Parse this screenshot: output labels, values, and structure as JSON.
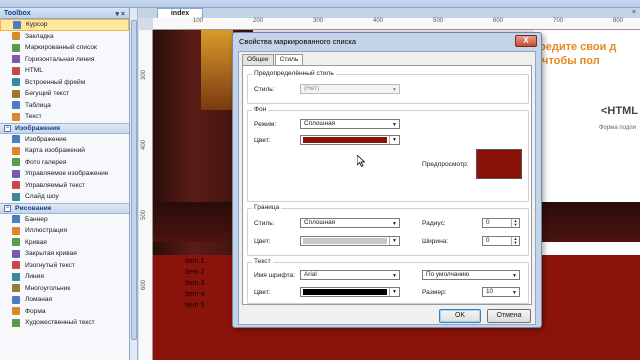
{
  "colors": {
    "accent": "#e38a1f",
    "dark_red": "#8b1208",
    "selection": "#ffe79c"
  },
  "toolbox": {
    "title": "Toolbox",
    "pin": "▾ ×",
    "items_top": [
      {
        "label": "Курсор",
        "icon": "cursor-icon",
        "selected": true
      },
      {
        "label": "Закладка",
        "icon": "bookmark-icon"
      },
      {
        "label": "Маркированный список",
        "icon": "bulleted-list-icon"
      },
      {
        "label": "Горизонтальная линия",
        "icon": "horizontal-line-icon"
      },
      {
        "label": "HTML",
        "icon": "html-icon"
      },
      {
        "label": "Встроенный фрейм",
        "icon": "iframe-icon"
      },
      {
        "label": "Бегущий текст",
        "icon": "marquee-icon"
      },
      {
        "label": "Таблица",
        "icon": "table-icon"
      },
      {
        "label": "Текст",
        "icon": "text-icon"
      }
    ],
    "group_images": "Изображения",
    "items_images": [
      {
        "label": "Изображение",
        "icon": "image-icon"
      },
      {
        "label": "Карта изображений",
        "icon": "image-map-icon"
      },
      {
        "label": "Фото галерея",
        "icon": "photo-gallery-icon"
      },
      {
        "label": "Управляемое изображение",
        "icon": "managed-image-icon"
      },
      {
        "label": "Управляемый текст",
        "icon": "managed-text-icon"
      },
      {
        "label": "Слайд шоу",
        "icon": "slideshow-icon"
      }
    ],
    "group_draw": "Рисование",
    "items_draw": [
      {
        "label": "Баннер",
        "icon": "banner-icon"
      },
      {
        "label": "Иллюстрация",
        "icon": "illustration-icon"
      },
      {
        "label": "Кривая",
        "icon": "curve-icon"
      },
      {
        "label": "Закрытая кривая",
        "icon": "closed-curve-icon"
      },
      {
        "label": "Изогнутый текст",
        "icon": "curved-text-icon"
      },
      {
        "label": "Линия",
        "icon": "line-icon"
      },
      {
        "label": "Многоугольник",
        "icon": "polygon-icon"
      },
      {
        "label": "Ломаная",
        "icon": "polyline-icon"
      },
      {
        "label": "Форма",
        "icon": "shape-icon"
      },
      {
        "label": "Художественный текст",
        "icon": "art-text-icon"
      }
    ]
  },
  "editor": {
    "tab": "index",
    "tab_close": "×",
    "ruler_h": [
      "100",
      "200",
      "300",
      "400",
      "500",
      "600",
      "700",
      "800"
    ],
    "ruler_v": [
      "300",
      "400",
      "500",
      "600"
    ],
    "canvas_text_orange": "редите свои д\n чтобы пол",
    "canvas_html": "<HTML",
    "canvas_forma": "Форма подпи",
    "list_items": [
      "Item 1",
      "Item 2",
      "Item 3",
      "Item 4",
      "Item 5"
    ]
  },
  "dialog": {
    "title": "Свойства маркированного списка",
    "close": "X",
    "tabs": [
      "Общее",
      "Стиль"
    ],
    "active_tab": "Стиль",
    "predefined": {
      "title": "Предопределённый стиль",
      "style_label": "Стиль:",
      "style_value": "(Нет)"
    },
    "background": {
      "title": "Фон",
      "mode_label": "Режим:",
      "mode_value": "Сплошная",
      "color_label": "Цвет:",
      "color": "#8b1208",
      "preview_label": "Предпросмотр:"
    },
    "border": {
      "title": "Граница",
      "style_label": "Стиль:",
      "style_value": "Сплошная",
      "color_label": "Цвет:",
      "color": "#c6c6c6",
      "radius_label": "Радиус:",
      "radius_value": "0",
      "width_label": "Ширина:",
      "width_value": "0"
    },
    "text": {
      "title": "Текст",
      "font_label": "Имя шрифта:",
      "font_value": "Arial",
      "font_mode": "По умолчанию",
      "color_label": "Цвет:",
      "color": "#000000",
      "size_label": "Размер:",
      "size_value": "10"
    },
    "ok": "OK",
    "cancel": "Отмена"
  }
}
